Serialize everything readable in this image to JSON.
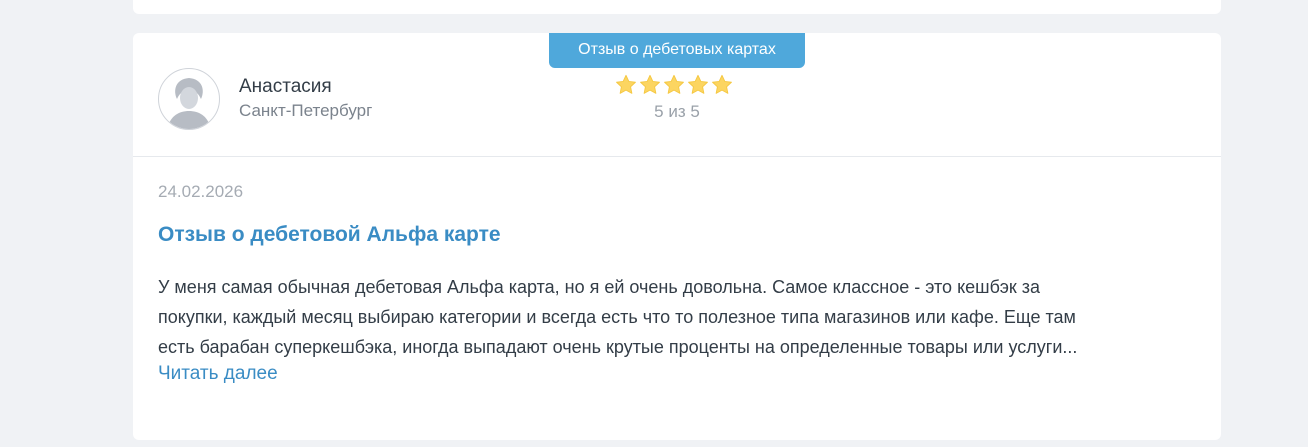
{
  "review": {
    "category_tag": "Отзыв о дебетовых картах",
    "author": {
      "name": "Анастасия",
      "city": "Санкт-Петербург",
      "avatar_icon": "user-avatar-icon"
    },
    "rating": {
      "value": 5,
      "max": 5,
      "text": "5 из 5",
      "star_color": "#fcd561"
    },
    "date": "24.02.2026",
    "title": "Отзыв о дебетовой Альфа карте",
    "text_lines": [
      "У меня самая обычная дебетовая Альфа карта, но я ей очень довольна. Самое классное - это кешбэк за",
      "покупки, каждый месяц выбираю категории и всегда есть что то полезное типа магазинов или кафе. Еще там",
      "есть барабан суперкешбэка, иногда выпадают очень крутые проценты на определенные товары или услуги..."
    ],
    "read_more": "Читать далее"
  },
  "colors": {
    "accent": "#4fa8db",
    "link": "#3a8cc4",
    "background": "#f0f2f5"
  }
}
